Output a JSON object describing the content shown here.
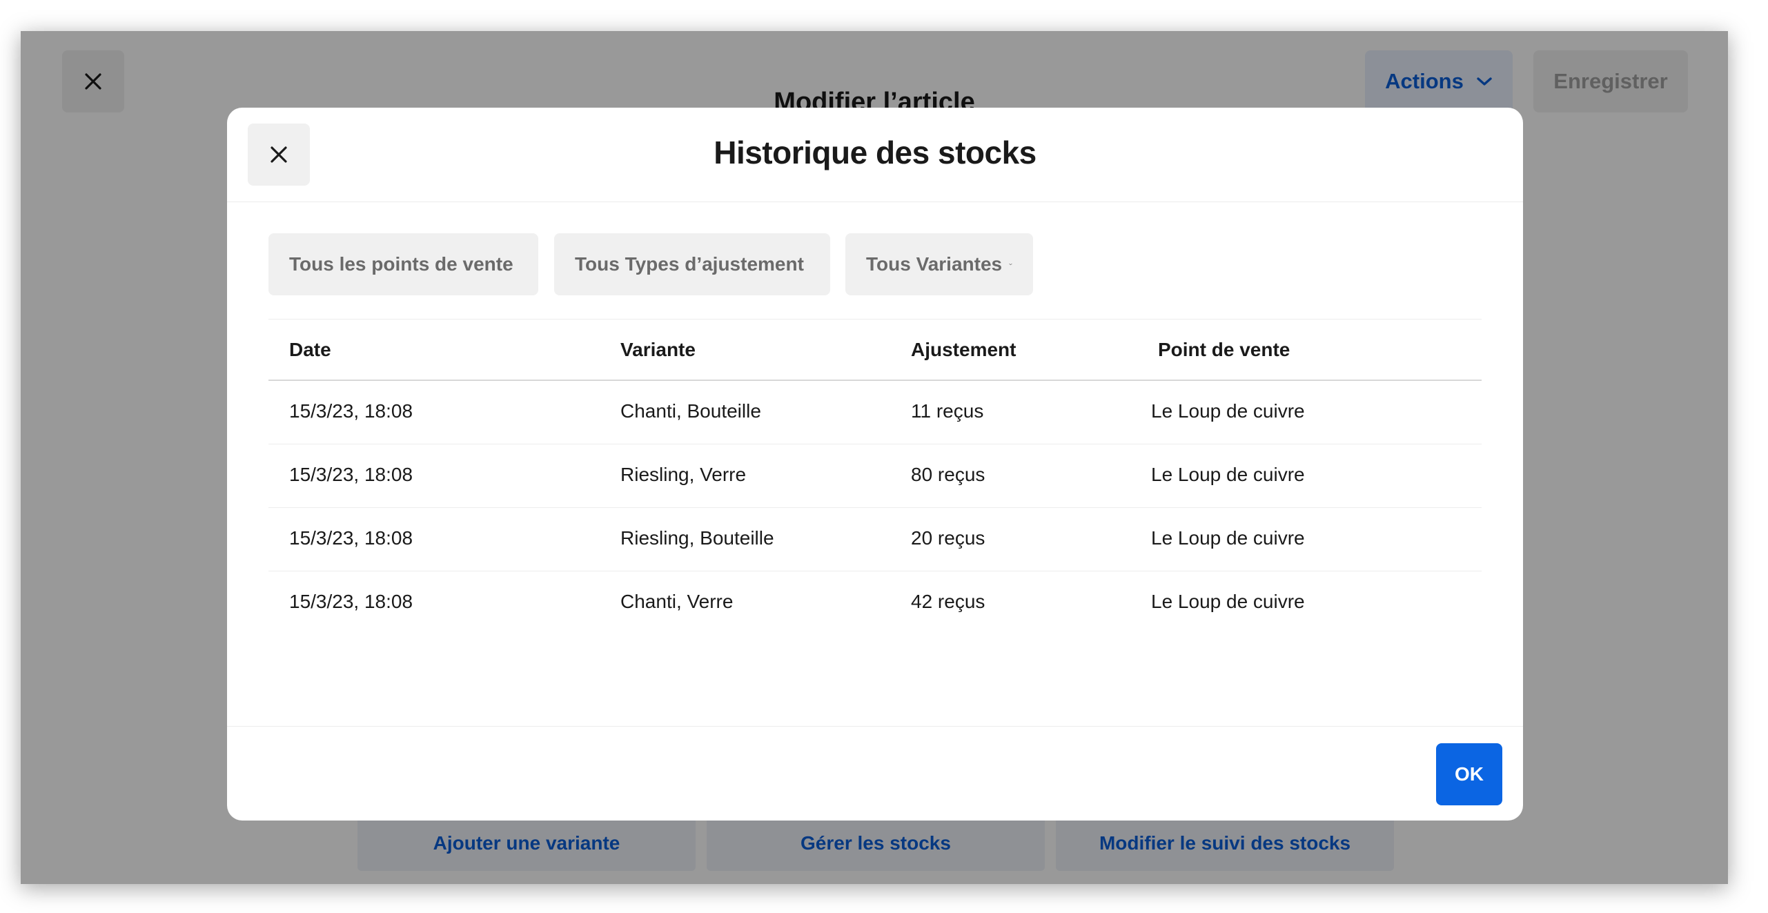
{
  "app": {
    "title": "Modifier l’article",
    "actions_label": "Actions",
    "save_label": "Enregistrer",
    "bottom_buttons": [
      "Ajouter une variante",
      "Gérer les stocks",
      "Modifier le suivi des stocks"
    ],
    "accent_color": "#0b5ed7"
  },
  "modal": {
    "title": "Historique des stocks",
    "filters": [
      "Tous les points de vente",
      "Tous Types d’ajustement",
      "Tous Variantes"
    ],
    "columns": [
      "Date",
      "Variante",
      "Ajustement",
      "Point de vente"
    ],
    "rows": [
      [
        "15/3/23, 18:08",
        "Chanti, Bouteille",
        "11 reçus",
        "Le Loup de cuivre"
      ],
      [
        "15/3/23, 18:08",
        "Riesling, Verre",
        "80 reçus",
        "Le Loup de cuivre"
      ],
      [
        "15/3/23, 18:08",
        "Riesling, Bouteille",
        "20 reçus",
        "Le Loup de cuivre"
      ],
      [
        "15/3/23, 18:08",
        "Chanti, Verre",
        "42 reçus",
        "Le Loup de cuivre"
      ]
    ],
    "ok_label": "OK",
    "primary_color": "#0b65e3"
  },
  "icons": {
    "close": "close-icon",
    "chevron": "chevron-down-icon"
  }
}
